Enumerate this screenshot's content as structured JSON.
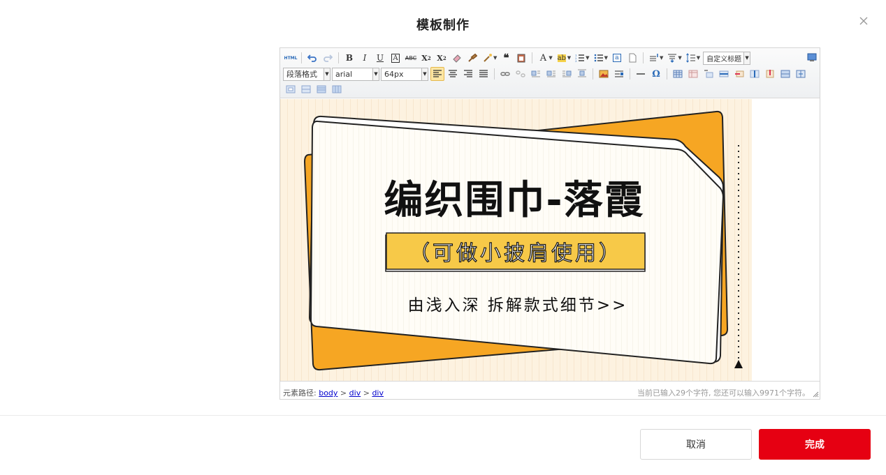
{
  "dialog": {
    "title": "模板制作",
    "cancel_label": "取消",
    "done_label": "完成"
  },
  "toolbar": {
    "paragraph_format": "段落格式",
    "font_family": "arial",
    "font_size": "64px",
    "custom_title": "自定义标题",
    "html_label": "HTML"
  },
  "template": {
    "title": "编织围巾-落霞",
    "subtitle": "（可做小披肩使用）",
    "tagline": "由浅入深 拆解款式细节>>"
  },
  "statusbar": {
    "path_prefix": "元素路径:",
    "path_items": [
      "body",
      "div",
      "div"
    ],
    "word_count": "当前已输入29个字符, 您还可以输入9971个字符。"
  },
  "colors": {
    "accent_red": "#e60012",
    "banner_yellow": "#f7c948",
    "card_orange": "#f6a623",
    "stripe_bg": "#fdf0dc"
  }
}
